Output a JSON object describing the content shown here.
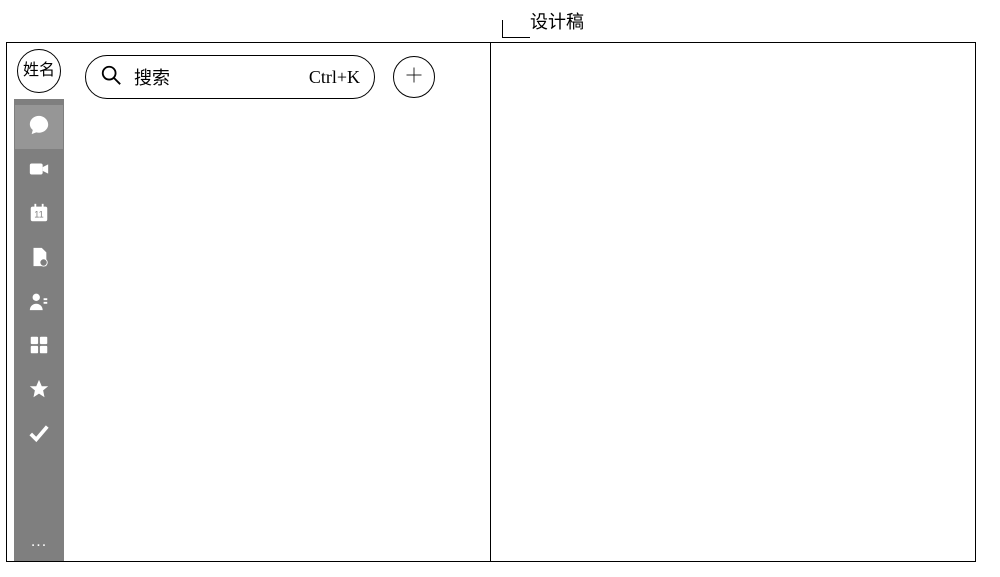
{
  "annotation": {
    "label": "设计稿"
  },
  "sidebar": {
    "avatar_label": "姓名",
    "more_label": "..."
  },
  "search": {
    "placeholder": "搜索",
    "shortcut": "Ctrl+K"
  },
  "icons": {
    "chat": "chat-icon",
    "video": "video-icon",
    "calendar": "calendar-icon",
    "doc": "document-icon",
    "contacts": "contacts-icon",
    "apps": "apps-icon",
    "favorite": "star-icon",
    "todo": "check-icon"
  }
}
